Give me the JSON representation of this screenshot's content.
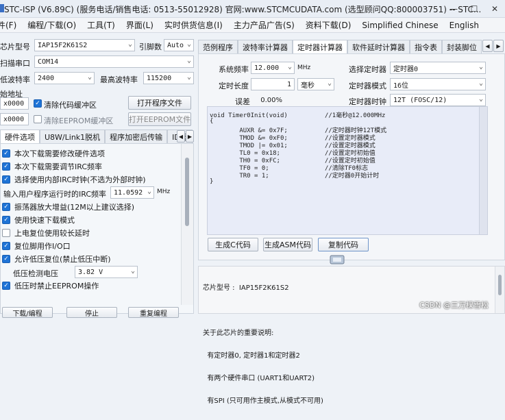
{
  "titlebar": {
    "title": "STC-ISP (V6.89C) (服务电话/销售电话: 0513-55012928) 官网:www.STCMCUDATA.com  (选型顾问QQ:800003751) -- STC..."
  },
  "menu": [
    "件(F)",
    "编程/下载(O)",
    "工具(T)",
    "界面(L)",
    "实时供货信息(I)",
    "主力产品广告(S)",
    "资料下载(D)",
    "Simplified Chinese",
    "English"
  ],
  "left": {
    "chip_label": "芯片型号",
    "chip_value": "IAP15F2K61S2",
    "pin_label": "引脚数",
    "pin_value": "Auto",
    "port_label": "扫描串口",
    "port_value": "COM14",
    "min_baud_label": "低波特率",
    "min_baud_value": "2400",
    "max_baud_label": "最高波特率",
    "max_baud_value": "115200",
    "start_label": "始地址",
    "addr1_value": "x0000",
    "clear_code_label": "清除代码缓冲区",
    "open_program_btn": "打开程序文件",
    "addr2_value": "x0000",
    "clear_eeprom_label": "清除EEPROM缓冲区",
    "open_eeprom_btn": "打开EEPROM文件",
    "tabs": [
      "硬件选项",
      "U8W/Link1脱机",
      "程序加密后传输",
      "ID号"
    ],
    "options": [
      "本次下载需要修改硬件选项",
      "本次下载需要调节IRC频率",
      "选择使用内部IRC时钟(不选为外部时钟)"
    ],
    "irc_label": "输入用户程序运行时的IRC频率",
    "irc_value": "11.0592",
    "irc_unit": "MHz",
    "options2": [
      "振荡器放大增益(12M以上建议选择)",
      "使用快速下载模式",
      "上电复位使用较长延时",
      "复位脚用作I/O口",
      "允许低压复位(禁止低压中断)"
    ],
    "lv_label": "低压检测电压",
    "lv_value": "3.82 V",
    "options3": [
      "低压时禁止EEPROM操作"
    ],
    "bottom_buttons": [
      "下载/编程",
      "停止",
      "重复编程"
    ]
  },
  "right": {
    "tabs": [
      "范例程序",
      "波特率计算器",
      "定时器计算器",
      "软件延时计算器",
      "指令表",
      "封装脚位"
    ],
    "sysfreq_label": "系统频率",
    "sysfreq_value": "12.000",
    "sysfreq_unit": "MHz",
    "timer_sel_label": "选择定时器",
    "timer_sel_value": "定时器0",
    "len_label": "定时长度",
    "len_value": "1",
    "len_unit": "毫秒",
    "mode_label": "定时器模式",
    "mode_value": "16位",
    "err_label": "误差",
    "err_value": "0.00%",
    "clock_label": "定时器时钟",
    "clock_value": "12T (FOSC/12)",
    "code_lines": [
      "void Timer0Init(void)          //1毫秒@12.000MHz",
      "{",
      "        AUXR &= 0x7F;          //定时器时钟12T模式",
      "        TMOD &= 0xF0;          //设置定时器模式",
      "        TMOD |= 0x01;          //设置定时器模式",
      "        TL0 = 0x18;            //设置定时初始值",
      "        TH0 = 0xFC;            //设置定时初始值",
      "        TF0 = 0;               //清除TF0标志",
      "        TR0 = 1;               //定时器0开始计时",
      "}"
    ],
    "gen_c_btn": "生成C代码",
    "gen_asm_btn": "生成ASM代码",
    "copy_btn": "复制代码"
  },
  "info": {
    "lines": [
      "芯片型号 :  IAP15F2K61S2",
      "",
      "关于此芯片的重要说明:",
      "  有定时器0, 定时器1和定时器2",
      "  有两个硬件串口 (UART1和UART2)",
      "  有SPI (只可用作主模式,从模式不可用)"
    ]
  },
  "watermark": "CSDN @三万棵雪松"
}
